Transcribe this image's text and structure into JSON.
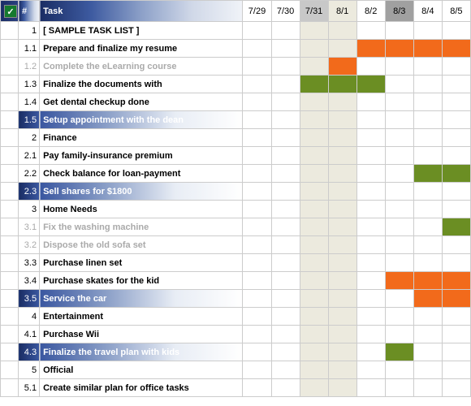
{
  "chart_data": {
    "type": "table",
    "title": "Task List Gantt",
    "dates": [
      "7/29",
      "7/30",
      "7/31",
      "8/1",
      "8/2",
      "8/3",
      "8/4",
      "8/5"
    ],
    "shaded_date_cols": [
      2,
      3
    ],
    "header_shade_map": [
      "",
      "",
      "shade1",
      "shade2",
      "",
      "dark",
      "",
      ""
    ],
    "rows": [
      {
        "num": "1",
        "task": "[ SAMPLE TASK LIST ]",
        "style": "normal",
        "bars": []
      },
      {
        "num": "1.1",
        "task": "Prepare and finalize my resume",
        "style": "normal",
        "bars": [
          {
            "col": 4,
            "span": 4,
            "color": "orange"
          }
        ]
      },
      {
        "num": "1.2",
        "task": "Complete the eLearning course",
        "style": "grey",
        "bars": [
          {
            "col": 3,
            "span": 1,
            "color": "orange"
          }
        ]
      },
      {
        "num": "1.3",
        "task": "Finalize the documents with",
        "style": "normal",
        "bars": [
          {
            "col": 2,
            "span": 3,
            "color": "green"
          }
        ]
      },
      {
        "num": "1.4",
        "task": "Get dental checkup done",
        "style": "normal",
        "bars": []
      },
      {
        "num": "1.5",
        "task": "Setup appointment with the dean",
        "style": "highlight",
        "bars": []
      },
      {
        "num": "2",
        "task": "Finance",
        "style": "normal",
        "bars": []
      },
      {
        "num": "2.1",
        "task": "Pay family-insurance premium",
        "style": "normal",
        "bars": []
      },
      {
        "num": "2.2",
        "task": "Check balance for loan-payment",
        "style": "normal",
        "bars": [
          {
            "col": 6,
            "span": 2,
            "color": "green"
          }
        ]
      },
      {
        "num": "2.3",
        "task": "Sell shares for $1800",
        "style": "highlight",
        "bars": []
      },
      {
        "num": "3",
        "task": "Home Needs",
        "style": "normal",
        "bars": []
      },
      {
        "num": "3.1",
        "task": "Fix the washing machine",
        "style": "grey",
        "bars": [
          {
            "col": 7,
            "span": 1,
            "color": "green"
          }
        ]
      },
      {
        "num": "3.2",
        "task": "Dispose the old sofa set",
        "style": "grey",
        "bars": []
      },
      {
        "num": "3.3",
        "task": "Purchase linen set",
        "style": "normal",
        "bars": []
      },
      {
        "num": "3.4",
        "task": "Purchase skates for the kid",
        "style": "normal",
        "bars": [
          {
            "col": 5,
            "span": 3,
            "color": "orange"
          }
        ]
      },
      {
        "num": "3.5",
        "task": "Service the car",
        "style": "highlight",
        "bars": [
          {
            "col": 6,
            "span": 2,
            "color": "orange"
          }
        ]
      },
      {
        "num": "4",
        "task": "Entertainment",
        "style": "normal",
        "bars": []
      },
      {
        "num": "4.1",
        "task": "Purchase Wii",
        "style": "normal",
        "bars": []
      },
      {
        "num": "4.3",
        "task": "Finalize the travel plan with kids",
        "style": "highlight",
        "bars": [
          {
            "col": 5,
            "span": 1,
            "color": "green"
          }
        ]
      },
      {
        "num": "5",
        "task": "Official",
        "style": "normal",
        "bars": []
      },
      {
        "num": "5.1",
        "task": "Create similar plan for office tasks",
        "style": "normal",
        "bars": []
      }
    ]
  },
  "headers": {
    "num": "#",
    "task": "Task"
  }
}
